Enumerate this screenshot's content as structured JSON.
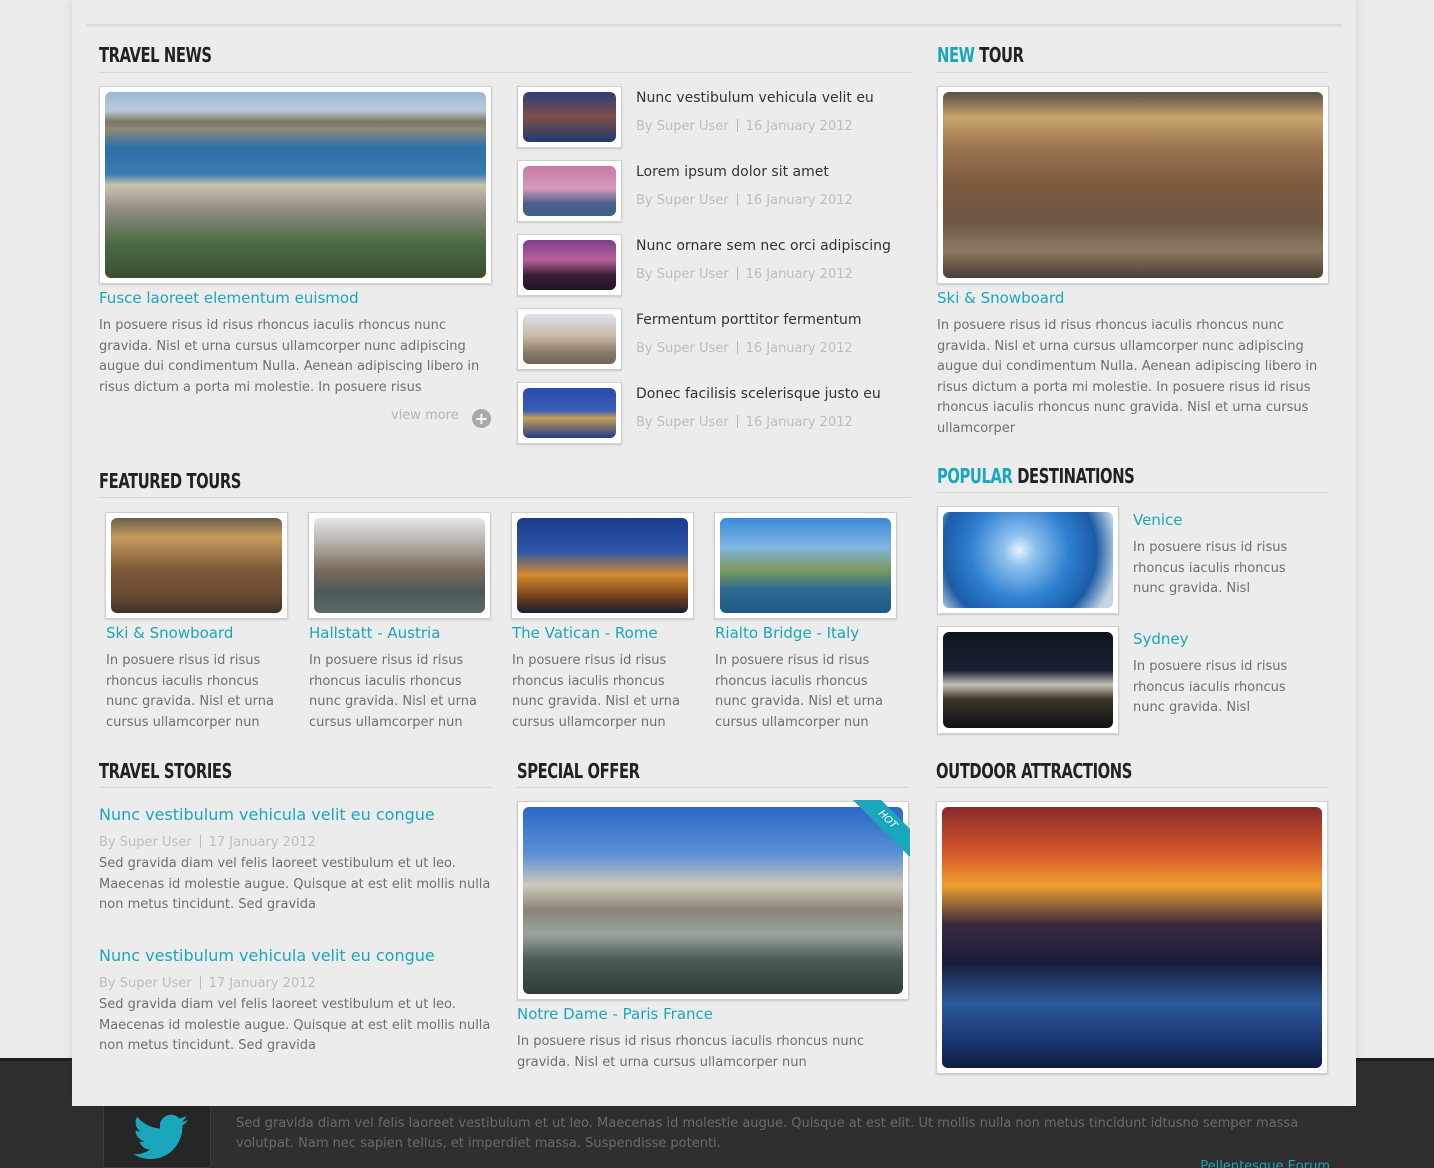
{
  "travel_news": {
    "heading": "TRAVEL NEWS",
    "featured": {
      "title": "Fusce laoreet elementum euismod",
      "body": "In posuere risus id risus rhoncus iaculis rhoncus nunc gravida. Nisl et urna cursus ullamcorper nunc adipiscing augue dui condimentum Nulla. Aenean adipiscing libero in risus dictum a porta mi molestie. In posuere risus",
      "view_more": "view more",
      "plus_icon": "+"
    },
    "items": [
      {
        "title": "Nunc vestibulum vehicula velit eu",
        "author": "By Super User",
        "date": "16 January 2012"
      },
      {
        "title": "Lorem ipsum dolor sit amet",
        "author": "By Super User",
        "date": "16 January 2012"
      },
      {
        "title": "Nunc ornare sem nec orci adipiscing",
        "author": "By Super User",
        "date": "16 January 2012"
      },
      {
        "title": "Fermentum porttitor fermentum",
        "author": "By Super User",
        "date": "16 January 2012"
      },
      {
        "title": "Donec facilisis scelerisque justo eu",
        "author": "By Super User",
        "date": "16 January 2012"
      }
    ]
  },
  "new_tour": {
    "heading_accent": "NEW",
    "heading_rest": "TOUR",
    "title": "Ski & Snowboard",
    "body": "In posuere risus id risus rhoncus iaculis rhoncus nunc gravida. Nisl et urna cursus ullamcorper nunc adipiscing augue dui condimentum Nulla. Aenean adipiscing libero in risus dictum a porta mi molestie. In posuere risus id risus rhoncus iaculis rhoncus nunc gravida. Nisl et urna cursus ullamcorper"
  },
  "featured_tours": {
    "heading": "FEATURED TOURS",
    "items": [
      {
        "title": "Ski & Snowboard",
        "body": "In posuere risus id risus rhoncus iaculis rhoncus nunc gravida. Nisl et urna cursus ullamcorper nun"
      },
      {
        "title": "Hallstatt - Austria",
        "body": "In posuere risus id risus rhoncus iaculis rhoncus nunc gravida. Nisl et urna cursus ullamcorper nun"
      },
      {
        "title": "The Vatican - Rome",
        "body": "In posuere risus id risus rhoncus iaculis rhoncus nunc gravida. Nisl et urna cursus ullamcorper nun"
      },
      {
        "title": "Rialto Bridge - Italy",
        "body": "In posuere risus id risus rhoncus iaculis rhoncus nunc gravida. Nisl et urna cursus ullamcorper nun"
      }
    ]
  },
  "popular_destinations": {
    "heading_accent": "POPULAR",
    "heading_rest": "DESTINATIONS",
    "items": [
      {
        "title": "Venice",
        "body": "In posuere risus id risus rhoncus iaculis rhoncus nunc gravida. Nisl"
      },
      {
        "title": "Sydney",
        "body": "In posuere risus id risus rhoncus iaculis rhoncus nunc gravida. Nisl"
      }
    ]
  },
  "travel_stories": {
    "heading": "TRAVEL STORIES",
    "items": [
      {
        "title": "Nunc vestibulum vehicula velit eu congue",
        "author": "By Super User",
        "date": "17 January 2012",
        "body": "Sed gravida diam vel felis laoreet vestibulum et ut leo. Maecenas id molestie augue. Quisque at est elit mollis nulla non metus tincidunt. Sed gravida"
      },
      {
        "title": "Nunc vestibulum vehicula velit eu congue",
        "author": "By Super User",
        "date": "17 January 2012",
        "body": "Sed gravida diam vel felis laoreet vestibulum et ut leo. Maecenas id molestie augue. Quisque at est elit mollis nulla non metus tincidunt. Sed gravida"
      }
    ]
  },
  "special_offer": {
    "heading": "SPECIAL OFFER",
    "badge": "HOT",
    "title": "Notre Dame - Paris France",
    "body": "In posuere risus id risus rhoncus iaculis rhoncus nunc gravida. Nisl et urna cursus ullamcorper nun"
  },
  "outdoor_attractions": {
    "heading": "OUTDOOR ATTRACTIONS"
  },
  "footer": {
    "text": "Sed gravida diam vel felis laoreet vestibulum et ut leo. Maecenas id molestie augue. Quisque at est elit. Ut mollis nulla non metus tincidunt idtusno semper massa volutpat. Nam nec sapien tellus, et imperdiet massa. Suspendisse potenti.",
    "link": "Pellentesque Eorum"
  },
  "colors": {
    "accent": "#1aa6bb",
    "heading": "#222222",
    "text": "#6f6f6f",
    "meta": "#bdbdbd",
    "footer_bg": "#2f2f2f"
  }
}
